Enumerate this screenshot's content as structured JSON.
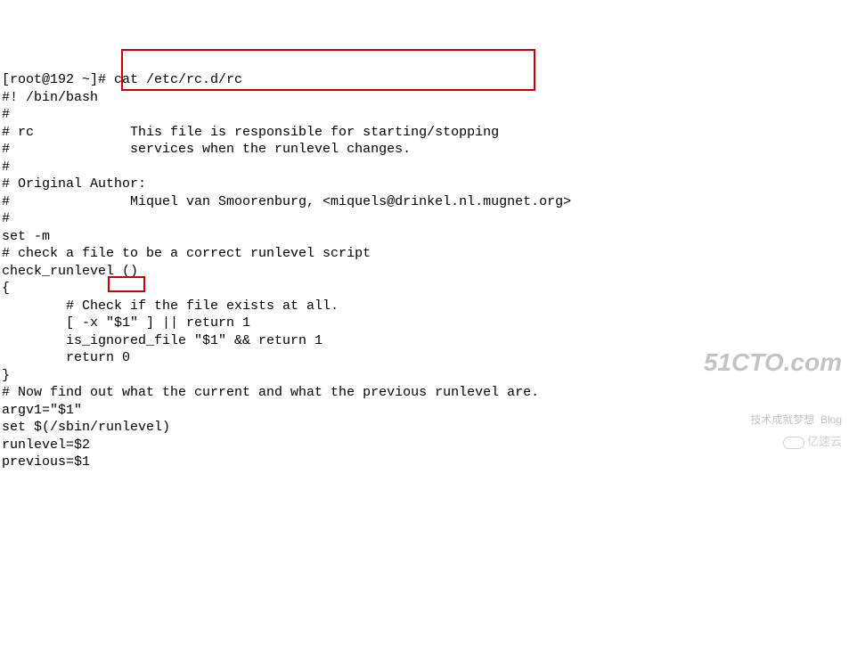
{
  "terminal": {
    "prompt": "[root@192 ~]# ",
    "command": "cat /etc/rc.d/rc",
    "lines": [
      "#! /bin/bash",
      "#",
      "# rc            This file is responsible for starting/stopping",
      "#               services when the runlevel changes.",
      "#",
      "# Original Author:",
      "#               Miquel van Smoorenburg, <miquels@drinkel.nl.mugnet.org>",
      "#",
      "",
      "set -m",
      "",
      "# check a file to be a correct runlevel script",
      "check_runlevel ()",
      "{",
      "        # Check if the file exists at all.",
      "        [ -x \"$1\" ] || return 1",
      "        is_ignored_file \"$1\" && return 1",
      "        return 0",
      "}",
      "",
      "# Now find out what the current and what the previous runlevel are.",
      "argv1=\"$1\"",
      "set $(/sbin/runlevel)",
      "runlevel=$2",
      "previous=$1"
    ]
  },
  "highlight1_desc": "This file is responsible for starting/stopping services when the runlevel changes.",
  "highlight2_desc": "\"$1\"",
  "watermark": {
    "main": "51CTO.com",
    "sub": "技术成就梦想  Blog",
    "second": "亿速云"
  }
}
